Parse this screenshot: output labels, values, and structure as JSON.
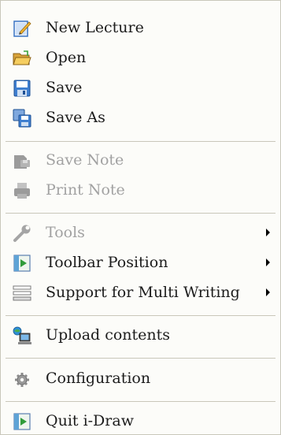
{
  "menu": {
    "items": [
      {
        "label": "New Lecture",
        "icon": "new-lecture-icon",
        "enabled": true
      },
      {
        "label": "Open",
        "icon": "open-folder-icon",
        "enabled": true
      },
      {
        "label": "Save",
        "icon": "save-disk-icon",
        "enabled": true
      },
      {
        "label": "Save As",
        "icon": "save-as-icon",
        "enabled": true
      },
      {
        "label": "Save Note",
        "icon": "save-note-icon",
        "enabled": false
      },
      {
        "label": "Print Note",
        "icon": "print-note-icon",
        "enabled": false
      },
      {
        "label": "Tools",
        "icon": "wrench-icon",
        "enabled": false,
        "submenu": true
      },
      {
        "label": "Toolbar Position",
        "icon": "toolbar-position-icon",
        "enabled": true,
        "submenu": true
      },
      {
        "label": "Support for Multi Writing",
        "icon": "multi-writing-icon",
        "enabled": true,
        "submenu": true
      },
      {
        "label": "Upload contents",
        "icon": "upload-computer-icon",
        "enabled": true
      },
      {
        "label": "Configuration",
        "icon": "gear-icon",
        "enabled": true
      },
      {
        "label": "Quit i-Draw",
        "icon": "quit-icon",
        "enabled": true
      }
    ]
  },
  "colors": {
    "background": "#fcfcf9",
    "separator": "#c9c7ba",
    "text": "#1c1c1c",
    "disabled_text": "#a2a2a2"
  }
}
